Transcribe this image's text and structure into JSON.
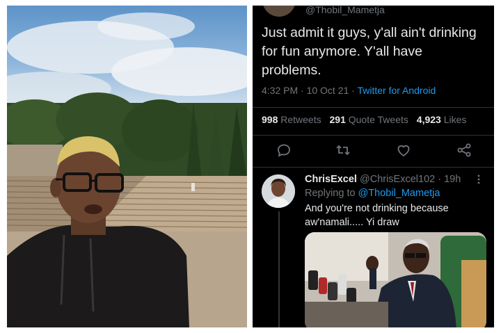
{
  "original_tweet": {
    "handle": "@Thobil_Mametja",
    "text": "Just admit it guys, y'all ain't drinking for fun anymore. Y'all have problems.",
    "time": "4:32 PM · 10 Oct 21 · ",
    "source": "Twitter for Android",
    "stats": {
      "retweets_count": "998",
      "retweets_label": "Retweets",
      "quote_count": "291",
      "quote_label": "Quote Tweets",
      "likes_count": "4,923",
      "likes_label": "Likes"
    },
    "action_icons": [
      "reply-icon",
      "retweet-icon",
      "like-icon",
      "share-icon"
    ]
  },
  "reply": {
    "name": "ChrisExcel",
    "handle": "@ChrisExcel102",
    "age": " · 19h",
    "replying_prefix": "Replying to ",
    "replying_to": "@Thobil_Mametja",
    "text": "And you're not drinking because aw'namali..... Yi draw",
    "more_icon": "more-icon"
  },
  "colors": {
    "background": "#000000",
    "text": "#e7e9ea",
    "secondary": "#71767b",
    "link": "#1d9bf0",
    "divider": "#2f3336"
  }
}
